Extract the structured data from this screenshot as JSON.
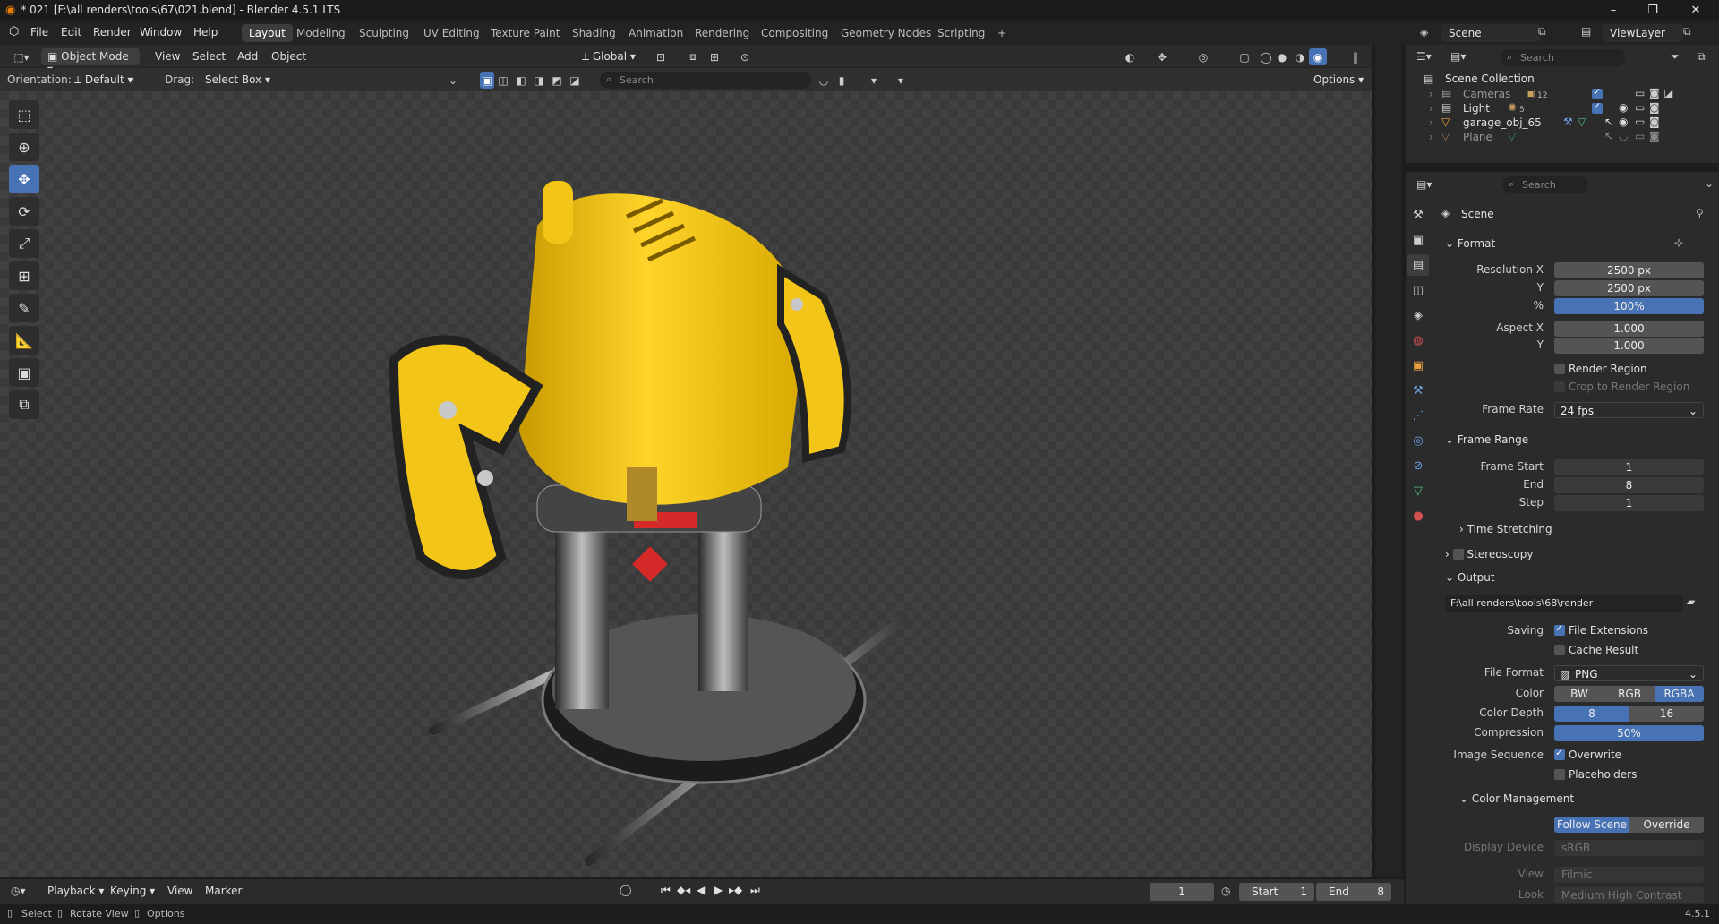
{
  "window": {
    "title": "* 021 [F:\\all renders\\tools\\67\\021.blend] - Blender 4.5.1 LTS",
    "controls": [
      "–",
      "❐",
      "✕"
    ]
  },
  "menu": {
    "items": [
      "File",
      "Edit",
      "Render",
      "Window",
      "Help"
    ],
    "workspaces": [
      "Layout",
      "Modeling",
      "Sculpting",
      "UV Editing",
      "Texture Paint",
      "Shading",
      "Animation",
      "Rendering",
      "Compositing",
      "Geometry Nodes",
      "Scripting"
    ],
    "add_tab": "+",
    "scene": "Scene",
    "view_layer": "ViewLayer"
  },
  "viewport": {
    "mode": "Object Mode",
    "header_menus": [
      "View",
      "Select",
      "Add",
      "Object"
    ],
    "transform_orientation": "Global",
    "orientation_label": "Orientation:",
    "orientation_value": "Default",
    "drag_label": "Drag:",
    "drag_value": "Select Box",
    "search_placeholder": "Search",
    "options_label": "Options"
  },
  "toolbar": {
    "tools": [
      "select-box",
      "cursor",
      "move",
      "rotate",
      "scale",
      "transform",
      "annotate",
      "measure",
      "add-cube",
      "extrude"
    ]
  },
  "outliner": {
    "search_placeholder": "Search",
    "root": "Scene Collection",
    "items": [
      {
        "name": "Cameras",
        "badge": "12"
      },
      {
        "name": "Light",
        "badge": "5"
      },
      {
        "name": "garage_obj_65",
        "badge": ""
      },
      {
        "name": "Plane",
        "badge": ""
      }
    ]
  },
  "properties": {
    "search_placeholder": "Search",
    "context": "Scene",
    "format": {
      "header": "Format",
      "resolution_x_label": "Resolution X",
      "resolution_x": "2500 px",
      "resolution_y_label": "Y",
      "resolution_y": "2500 px",
      "percent_label": "%",
      "percent": "100%",
      "aspect_x_label": "Aspect X",
      "aspect_x": "1.000",
      "aspect_y_label": "Y",
      "aspect_y": "1.000",
      "render_region": "Render Region",
      "crop_region": "Crop to Render Region",
      "frame_rate_label": "Frame Rate",
      "frame_rate": "24 fps"
    },
    "frame_range": {
      "header": "Frame Range",
      "start_label": "Frame Start",
      "start": "1",
      "end_label": "End",
      "end": "8",
      "step_label": "Step",
      "step": "1",
      "time_stretching": "Time Stretching"
    },
    "stereoscopy": "Stereoscopy",
    "output": {
      "header": "Output",
      "path": "F:\\all renders\\tools\\68\\render",
      "saving_label": "Saving",
      "file_extensions": "File Extensions",
      "cache_result": "Cache Result",
      "file_format_label": "File Format",
      "file_format": "PNG",
      "color_label": "Color",
      "color_options": [
        "BW",
        "RGB",
        "RGBA"
      ],
      "color_depth_label": "Color Depth",
      "color_depth_options": [
        "8",
        "16"
      ],
      "compression_label": "Compression",
      "compression": "50%",
      "image_sequence_label": "Image Sequence",
      "overwrite": "Overwrite",
      "placeholders": "Placeholders"
    },
    "color_management": {
      "header": "Color Management",
      "follow_scene": "Follow Scene",
      "override": "Override",
      "display_device_label": "Display Device",
      "display_device": "sRGB",
      "view_label": "View",
      "view": "Filmic",
      "look_label": "Look",
      "look": "Medium High Contrast"
    }
  },
  "timeline": {
    "menus": [
      "Playback",
      "Keying",
      "View",
      "Marker"
    ],
    "current_frame": "1",
    "start_label": "Start",
    "start": "1",
    "end_label": "End",
    "end": "8"
  },
  "status": {
    "select": "Select",
    "rotate": "Rotate View",
    "options": "Options",
    "version": "4.5.1"
  },
  "colors": {
    "accent": "#4772b3",
    "tool_yellow": "#f2c518",
    "grip_black": "#2a2a2a",
    "accent_red": "#d42a2a"
  }
}
